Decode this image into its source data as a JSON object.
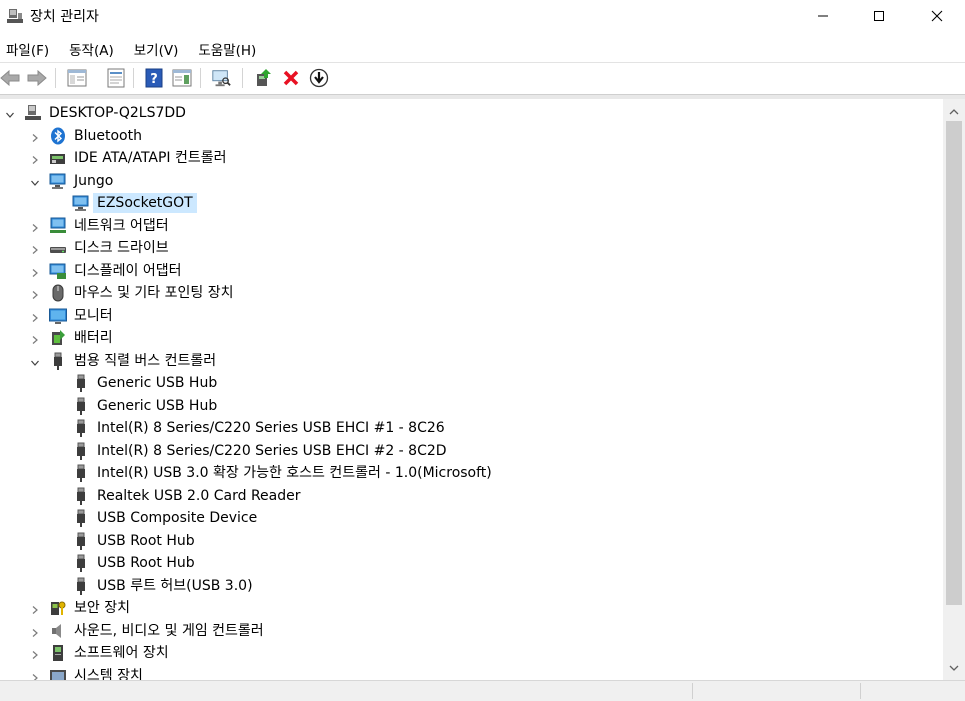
{
  "window": {
    "title": "장치 관리자",
    "controls": [
      "minimize",
      "maximize",
      "close"
    ]
  },
  "menu": [
    {
      "label": "파일(F)"
    },
    {
      "label": "동작(A)"
    },
    {
      "label": "보기(V)"
    },
    {
      "label": "도움말(H)"
    }
  ],
  "toolbar": {
    "buttons": [
      "back-icon",
      "forward-icon",
      "show-hide-console-tree-icon",
      "properties-icon",
      "help-icon",
      "action-pane-icon",
      "scan-hardware-icon",
      "update-driver-icon",
      "uninstall-device-icon",
      "disable-device-icon"
    ]
  },
  "tree": {
    "root": "DESKTOP-Q2LS7DD",
    "items": [
      {
        "label": "Bluetooth",
        "icon": "bluetooth-icon",
        "state": "collapsed"
      },
      {
        "label": "IDE ATA/ATAPI 컨트롤러",
        "icon": "ide-controller-icon",
        "state": "collapsed"
      },
      {
        "label": "Jungo",
        "icon": "network-monitor-icon",
        "state": "expanded"
      },
      {
        "label": "EZSocketGOT",
        "icon": "network-monitor-icon",
        "state": "leaf",
        "selected": true
      },
      {
        "label": "네트워크 어댑터",
        "icon": "network-adapter-icon",
        "state": "collapsed"
      },
      {
        "label": "디스크 드라이브",
        "icon": "disk-drive-icon",
        "state": "collapsed"
      },
      {
        "label": "디스플레이 어댑터",
        "icon": "display-adapter-icon",
        "state": "collapsed"
      },
      {
        "label": "마우스 및 기타 포인팅 장치",
        "icon": "mouse-icon",
        "state": "collapsed"
      },
      {
        "label": "모니터",
        "icon": "monitor-icon",
        "state": "collapsed"
      },
      {
        "label": "배터리",
        "icon": "battery-icon",
        "state": "collapsed"
      },
      {
        "label": "범용 직렬 버스 컨트롤러",
        "icon": "usb-icon",
        "state": "expanded"
      },
      {
        "label": "Generic USB Hub",
        "icon": "usb-icon",
        "state": "leaf"
      },
      {
        "label": "Generic USB Hub",
        "icon": "usb-icon",
        "state": "leaf"
      },
      {
        "label": "Intel(R) 8 Series/C220 Series USB EHCI #1 - 8C26",
        "icon": "usb-icon",
        "state": "leaf"
      },
      {
        "label": "Intel(R) 8 Series/C220 Series USB EHCI #2 - 8C2D",
        "icon": "usb-icon",
        "state": "leaf"
      },
      {
        "label": "Intel(R) USB 3.0 확장 가능한 호스트 컨트롤러 - 1.0(Microsoft)",
        "icon": "usb-icon",
        "state": "leaf"
      },
      {
        "label": "Realtek USB 2.0 Card Reader",
        "icon": "usb-icon",
        "state": "leaf"
      },
      {
        "label": "USB Composite Device",
        "icon": "usb-icon",
        "state": "leaf"
      },
      {
        "label": "USB Root Hub",
        "icon": "usb-icon",
        "state": "leaf"
      },
      {
        "label": "USB Root Hub",
        "icon": "usb-icon",
        "state": "leaf"
      },
      {
        "label": "USB 루트 허브(USB 3.0)",
        "icon": "usb-icon",
        "state": "leaf"
      },
      {
        "label": "보안 장치",
        "icon": "security-device-icon",
        "state": "collapsed"
      },
      {
        "label": "사운드, 비디오 및 게임 컨트롤러",
        "icon": "speaker-icon",
        "state": "collapsed"
      },
      {
        "label": "소프트웨어 장치",
        "icon": "software-device-icon",
        "state": "collapsed"
      },
      {
        "label": "시스템 장치",
        "icon": "system-device-icon",
        "state": "collapsed"
      }
    ]
  },
  "colors": {
    "selection": "#cce8ff",
    "accent_blue": "#1e73d1",
    "uninstall_red": "#e81123"
  }
}
